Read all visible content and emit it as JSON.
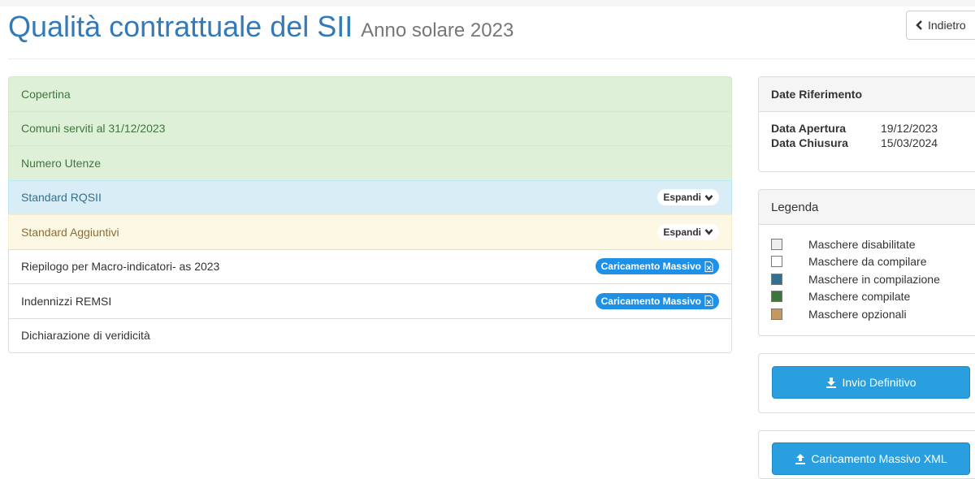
{
  "header": {
    "title": "Qualità contrattuale del SII",
    "subtitle": "Anno solare 2023",
    "back_label": "Indietro"
  },
  "sections": [
    {
      "label": "Copertina",
      "state": "success"
    },
    {
      "label": "Comuni serviti al 31/12/2023",
      "state": "success"
    },
    {
      "label": "Numero Utenze",
      "state": "success"
    },
    {
      "label": "Standard RQSII",
      "state": "info",
      "badge": "Espandi"
    },
    {
      "label": "Standard Aggiuntivi",
      "state": "warning",
      "badge": "Espandi"
    },
    {
      "label": "Riepilogo per Macro-indicatori- as 2023",
      "state": "plain",
      "badge": "Caricamento Massivo"
    },
    {
      "label": "Indennizzi REMSI",
      "state": "plain",
      "badge": "Caricamento Massivo"
    },
    {
      "label": "Dichiarazione di veridicità",
      "state": "plain"
    }
  ],
  "dates_panel": {
    "heading": "Date Riferimento",
    "apertura_label": "Data Apertura",
    "apertura_value": "19/12/2023",
    "chiusura_label": "Data Chiusura",
    "chiusura_value": "15/03/2024"
  },
  "legend_panel": {
    "heading": "Legenda",
    "items": [
      {
        "label": "Maschere disabilitate",
        "color": "#eeeeee"
      },
      {
        "label": "Maschere da compilare",
        "color": "#ffffff"
      },
      {
        "label": "Maschere in compilazione",
        "color": "#31708f"
      },
      {
        "label": "Maschere compilate",
        "color": "#3c763d"
      },
      {
        "label": "Maschere opzionali",
        "color": "#c49a5a"
      }
    ]
  },
  "actions": {
    "invio_label": "Invio Definitivo",
    "xml_label": "Caricamento Massivo XML"
  },
  "colors": {
    "title_blue": "#337ab7",
    "button_blue": "#2a9fe0",
    "badge_blue": "#1e90e6"
  }
}
